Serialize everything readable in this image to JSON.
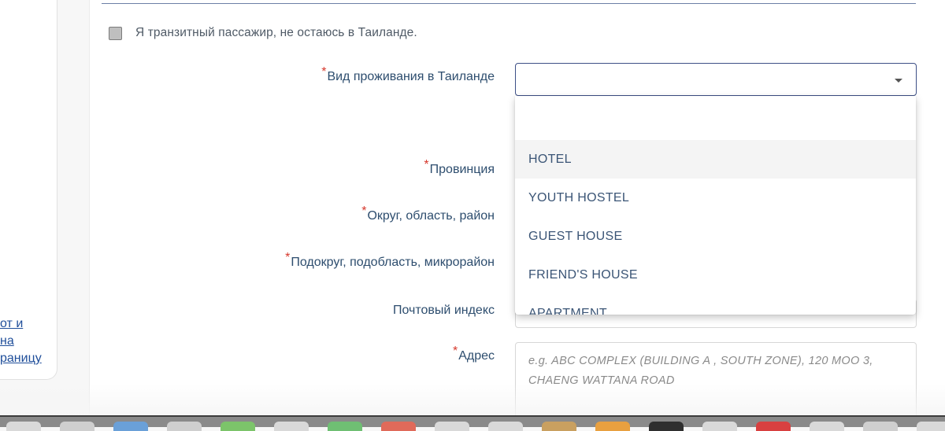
{
  "sidebar": {
    "link_text": "от и\nна\nраницу"
  },
  "form": {
    "transit_label": "Я транзитный пассажир, не остаюсь в Таиланде.",
    "required_mark": "*",
    "accommodation_type_label": "Вид проживания в Таиланде",
    "accommodation_type_value": "",
    "province_label": "Провинция",
    "district_label": "Округ, область, район",
    "subdistrict_label": "Подокруг, подобласть, микрорайон",
    "postal_code_label": "Почтовый индекс",
    "address_label": "Адрес",
    "address_placeholder": "e.g. ABC COMPLEX (BUILDING A , SOUTH ZONE), 120 MOO 3, CHAENG WATTANA ROAD"
  },
  "dropdown": {
    "options": [
      "HOTEL",
      "YOUTH HOSTEL",
      "GUEST HOUSE",
      "FRIEND'S HOUSE",
      "APARTMENT"
    ],
    "highlighted": "HOTEL"
  },
  "colors": {
    "accent": "#3d4f86",
    "required": "#d6382c",
    "text": "#2d4d6e",
    "link": "#1f4e9a"
  },
  "dock": {
    "icons": [
      {
        "color": "#d9d9d9"
      },
      {
        "color": "#cfcfcf"
      },
      {
        "color": "#6aa0d8"
      },
      {
        "color": "#cfcfcf"
      },
      {
        "color": "#7cc46a"
      },
      {
        "color": "#d9d9d9"
      },
      {
        "color": "#6fbf73"
      },
      {
        "color": "#e06a5a"
      },
      {
        "color": "#d9d9d9"
      },
      {
        "color": "#d9d9d9"
      },
      {
        "color": "#c9a060"
      },
      {
        "color": "#e8a040"
      },
      {
        "color": "#2f2f2f"
      },
      {
        "color": "#d9d9d9"
      },
      {
        "color": "#d84040"
      },
      {
        "color": "#d9d9d9"
      },
      {
        "color": "#cfcfcf"
      },
      {
        "color": "#d9d9d9"
      }
    ]
  }
}
